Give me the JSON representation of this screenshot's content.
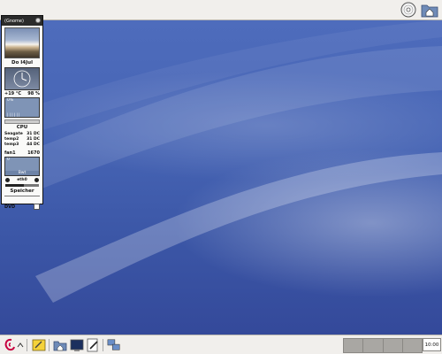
{
  "top_panel": {
    "icons": [
      "cd-drive-icon",
      "home-folder-icon"
    ]
  },
  "sidebar": {
    "header": "(Gnome)",
    "date": "Do I4Jul",
    "weather": {
      "temp": "+19 °C",
      "humidity": "98 %"
    },
    "cpu": {
      "graph_label": "0%",
      "graph_bottom": "| | | | | |",
      "title": "CPU"
    },
    "temps": [
      {
        "name": "Seagate",
        "value": "31 DC"
      },
      {
        "name": "temp2",
        "value": "31 DC"
      },
      {
        "name": "temp3",
        "value": "44 DC"
      }
    ],
    "fan": {
      "name": "fan1",
      "value": "1670"
    },
    "net": {
      "graph_label": "0",
      "graph_bottom": "Bwt"
    },
    "iface": "eth0",
    "memory_label": "Speicher",
    "memory_fill": 0.55,
    "dvd": "DVD"
  },
  "bottom_panel": {
    "clock": "10:00",
    "launchers": [
      "debian-menu-icon",
      "text-editor-icon",
      "home-folder-icon",
      "terminal-icon",
      "writer-icon",
      "network-icon"
    ],
    "workspaces": 4
  },
  "colors": {
    "desktop": "#4664b4",
    "panel": "#f1efec"
  }
}
